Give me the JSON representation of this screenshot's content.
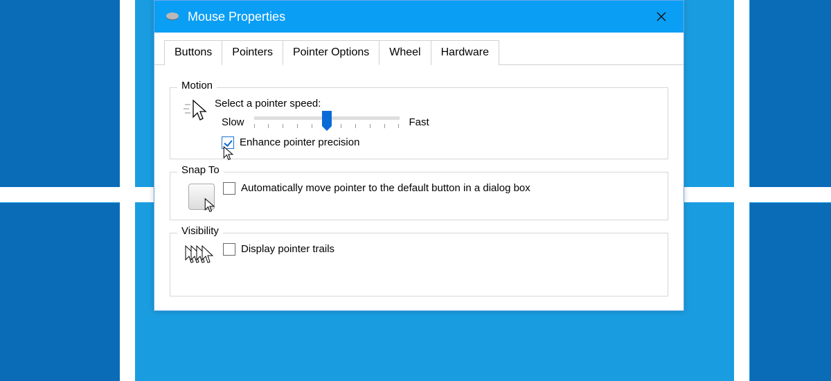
{
  "window": {
    "title": "Mouse Properties"
  },
  "tabs": [
    {
      "label": "Buttons",
      "active": false
    },
    {
      "label": "Pointers",
      "active": false
    },
    {
      "label": "Pointer Options",
      "active": true
    },
    {
      "label": "Wheel",
      "active": false
    },
    {
      "label": "Hardware",
      "active": false
    }
  ],
  "motion": {
    "legend": "Motion",
    "speed_label": "Select a pointer speed:",
    "slow_label": "Slow",
    "fast_label": "Fast",
    "enhance_label": "Enhance pointer precision",
    "enhance_checked": true
  },
  "snapto": {
    "legend": "Snap To",
    "auto_label": "Automatically move pointer to the default button in a dialog box",
    "auto_checked": false
  },
  "visibility": {
    "legend": "Visibility",
    "trails_label": "Display pointer trails",
    "trails_checked": false
  }
}
